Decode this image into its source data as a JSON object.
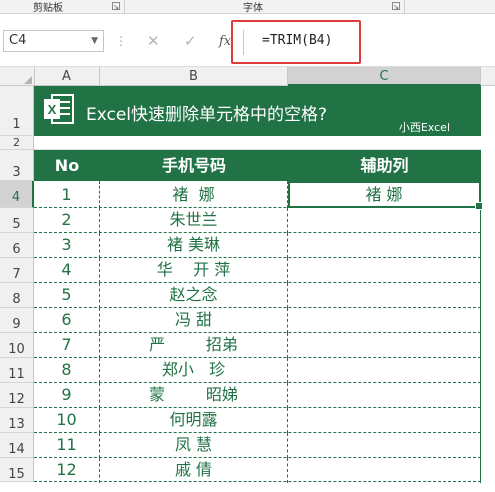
{
  "ribbon": {
    "group1": "剪贴板",
    "group2": "字体"
  },
  "formula_bar": {
    "cell_ref": "C4",
    "formula": "=TRIM(B4)",
    "cancel_glyph": "✕",
    "enter_glyph": "✓",
    "fx_glyph": "fx",
    "accent_color": "#e03b3b"
  },
  "columns": [
    "A",
    "B",
    "C"
  ],
  "rows": [
    "1",
    "2",
    "3",
    "4",
    "5",
    "6",
    "7",
    "8",
    "9",
    "10",
    "11",
    "12",
    "13",
    "14",
    "15"
  ],
  "banner": {
    "title": "Excel快速删除单元格中的空格?",
    "subtitle": "小西Excel",
    "bg_color": "#217346"
  },
  "table": {
    "headers": [
      "No",
      "手机号码",
      "辅助列"
    ],
    "rows": [
      {
        "no": "1",
        "name": "褚  娜",
        "helper": "褚 娜"
      },
      {
        "no": "2",
        "name": "朱世兰",
        "helper": ""
      },
      {
        "no": "3",
        "name": "褚 美琳",
        "helper": ""
      },
      {
        "no": "4",
        "name": "华    开 萍",
        "helper": ""
      },
      {
        "no": "5",
        "name": "赵之念",
        "helper": ""
      },
      {
        "no": "6",
        "name": "冯 甜",
        "helper": ""
      },
      {
        "no": "7",
        "name": "严        招弟",
        "helper": ""
      },
      {
        "no": "8",
        "name": "郑小   珍",
        "helper": ""
      },
      {
        "no": "9",
        "name": "蒙        昭娣",
        "helper": ""
      },
      {
        "no": "10",
        "name": "何明露",
        "helper": ""
      },
      {
        "no": "11",
        "name": "凤 慧",
        "helper": ""
      },
      {
        "no": "12",
        "name": "戚 倩",
        "helper": ""
      }
    ]
  }
}
